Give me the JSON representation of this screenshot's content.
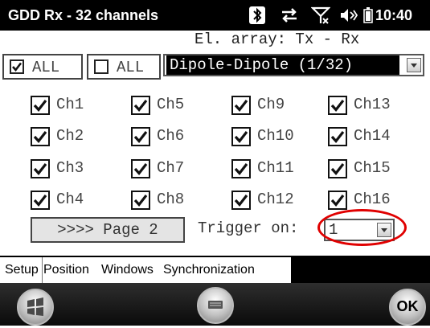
{
  "title_bar": {
    "app_title": "GDD Rx - 32 channels",
    "clock": "10:40",
    "icons": [
      "bluetooth-icon",
      "data-sync-icon",
      "no-signal-icon",
      "speaker-icon",
      "battery-icon"
    ]
  },
  "header": {
    "electrode_array_label": "El. array: Tx - Rx"
  },
  "select_all": [
    {
      "label": "ALL",
      "checked": true
    },
    {
      "label": "ALL",
      "checked": false
    }
  ],
  "mode_select": {
    "value": "Dipole-Dipole (1/32)"
  },
  "channels": [
    {
      "label": "Ch1",
      "checked": true
    },
    {
      "label": "Ch2",
      "checked": true
    },
    {
      "label": "Ch3",
      "checked": true
    },
    {
      "label": "Ch4",
      "checked": true
    },
    {
      "label": "Ch5",
      "checked": true
    },
    {
      "label": "Ch6",
      "checked": true
    },
    {
      "label": "Ch7",
      "checked": true
    },
    {
      "label": "Ch8",
      "checked": true
    },
    {
      "label": "Ch9",
      "checked": true
    },
    {
      "label": "Ch10",
      "checked": true
    },
    {
      "label": "Ch11",
      "checked": true
    },
    {
      "label": "Ch12",
      "checked": true
    },
    {
      "label": "Ch13",
      "checked": true
    },
    {
      "label": "Ch14",
      "checked": true
    },
    {
      "label": "Ch15",
      "checked": true
    },
    {
      "label": "Ch16",
      "checked": true
    }
  ],
  "page_button": {
    "label": ">>>> Page 2"
  },
  "trigger": {
    "label": "Trigger on:",
    "value": "1"
  },
  "tabs": [
    {
      "label": "Setup",
      "active": true
    },
    {
      "label": "Position",
      "active": false
    },
    {
      "label": "Windows",
      "active": false
    },
    {
      "label": "Synchronization",
      "active": false
    }
  ],
  "command_bar": {
    "start_icon": "windows-start-icon",
    "keyboard_icon": "keyboard-icon",
    "ok_label": "OK"
  },
  "colors": {
    "title_bar": "#000000",
    "highlight_ring": "#e00000",
    "selected_mode_bg": "#000000"
  }
}
